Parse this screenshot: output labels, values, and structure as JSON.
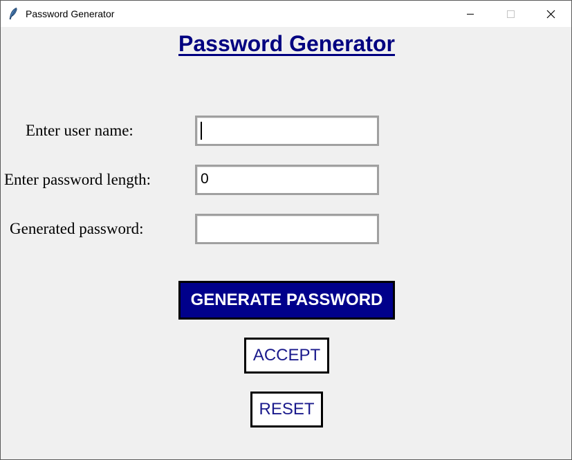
{
  "window": {
    "title": "Password Generator",
    "icon": "feather-icon",
    "controls": {
      "minimize_icon": "minimize-icon",
      "maximize_icon": "maximize-icon",
      "close_icon": "close-icon"
    }
  },
  "heading": "Password Generator",
  "form": {
    "username": {
      "label": "Enter user name:",
      "value": ""
    },
    "length": {
      "label": "Enter password length:",
      "value": "0"
    },
    "generated": {
      "label": "Generated password:",
      "value": ""
    }
  },
  "buttons": {
    "generate": "GENERATE PASSWORD",
    "accept": "ACCEPT",
    "reset": "RESET"
  },
  "colors": {
    "heading": "#000080",
    "generate_bg": "#00008b",
    "generate_text": "#ffffff",
    "secondary_text": "#1a1a8c",
    "background": "#f0f0f0"
  }
}
